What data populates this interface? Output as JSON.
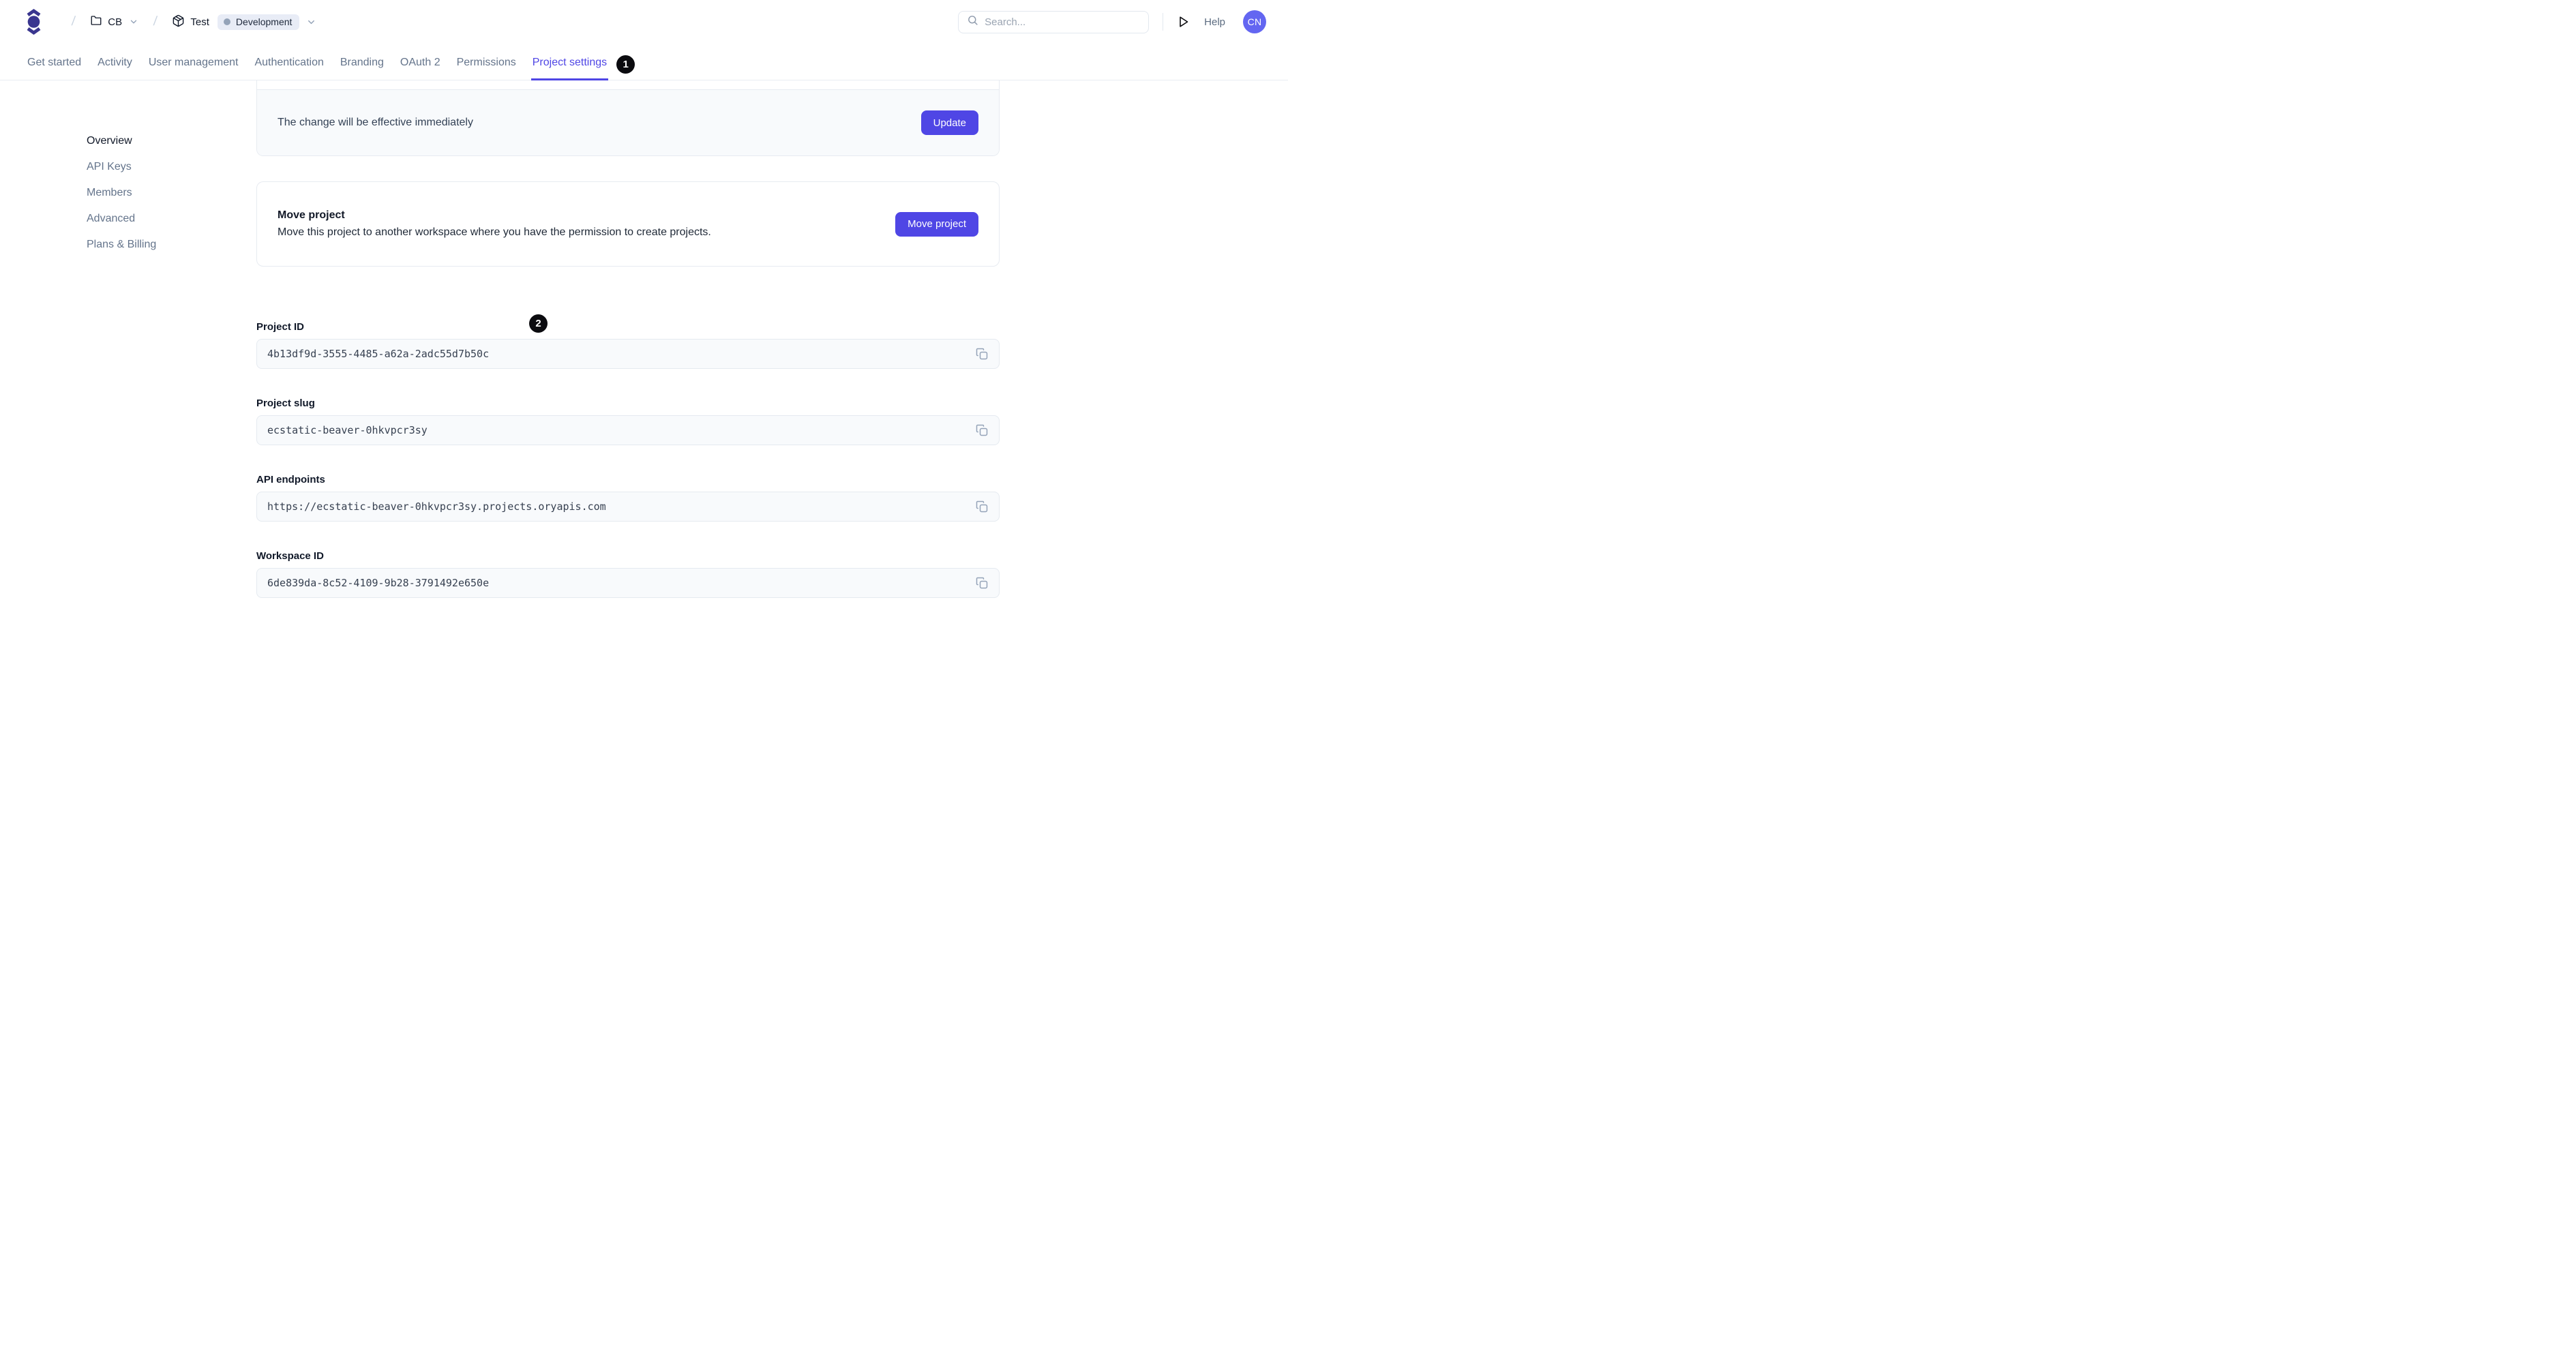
{
  "header": {
    "breadcrumb": {
      "separator": "/",
      "workspace": "CB",
      "project": "Test",
      "environment": "Development"
    },
    "search": {
      "placeholder": "Search..."
    },
    "help_label": "Help",
    "avatar_initials": "CN"
  },
  "tabs": {
    "items": [
      "Get started",
      "Activity",
      "User management",
      "Authentication",
      "Branding",
      "OAuth 2",
      "Permissions",
      "Project settings"
    ],
    "active": "Project settings"
  },
  "annotations": {
    "tab_marker": "1",
    "section_marker": "2"
  },
  "sidebar": {
    "items": [
      "Overview",
      "API Keys",
      "Members",
      "Advanced",
      "Plans & Billing"
    ],
    "active": "Overview"
  },
  "main": {
    "update_card": {
      "note": "The change will be effective immediately",
      "button": "Update"
    },
    "move_card": {
      "title": "Move project",
      "description": "Move this project to another workspace where you have the permission to create projects.",
      "button": "Move project"
    },
    "fields": [
      {
        "label": "Project ID",
        "value": "4b13df9d-3555-4485-a62a-2adc55d7b50c"
      },
      {
        "label": "Project slug",
        "value": "ecstatic-beaver-0hkvpcr3sy"
      },
      {
        "label": "API endpoints",
        "value": "https://ecstatic-beaver-0hkvpcr3sy.projects.oryapis.com"
      },
      {
        "label": "Workspace ID",
        "value": "6de839da-8c52-4109-9b28-3791492e650e"
      }
    ]
  },
  "icons": {
    "logo": "ory-logo",
    "workspace": "folder-icon",
    "project": "package-icon",
    "dropdown": "chevron-down-icon",
    "search": "search-icon",
    "quickstart": "play-icon",
    "copy": "copy-icon"
  },
  "colors": {
    "accent": "#4F46E5",
    "logo_indigo": "#3A368F",
    "avatar_bg": "#6366F1",
    "badge_bg": "#E8ECF6",
    "badge_dot": "#94A3B8",
    "input_bg": "#F8FAFC",
    "border": "#E7EBF1",
    "muted_text": "#64748B",
    "annotation_bg": "#0B0B0F"
  }
}
